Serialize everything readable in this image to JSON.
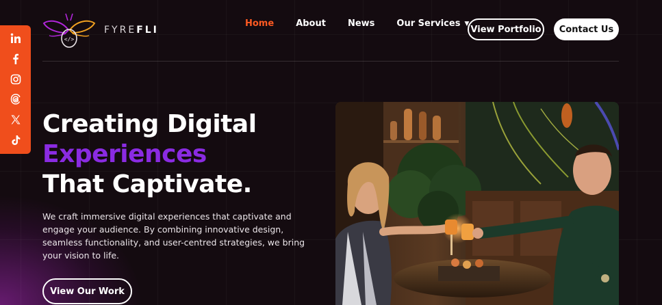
{
  "brand": {
    "logo_text_light": "FYRE",
    "logo_text_bold": "FLI"
  },
  "nav": {
    "items": [
      {
        "label": "Home",
        "active": true
      },
      {
        "label": "About"
      },
      {
        "label": "News"
      },
      {
        "label": "Our Services",
        "has_dropdown": true
      }
    ],
    "portfolio_button": "View Portfolio",
    "contact_button": "Contact Us"
  },
  "social": [
    "linkedin-icon",
    "facebook-icon",
    "instagram-icon",
    "threads-icon",
    "x-icon",
    "tiktok-icon"
  ],
  "hero": {
    "title_line1": "Creating Digital",
    "title_line2": "Experiences",
    "title_line3": "That Captivate.",
    "description": "We craft immersive digital experiences that captivate and engage your audience. By combining innovative design, seamless functionality, and user-centred strategies, we bring your vision to life.",
    "cta_label": "View Our Work"
  },
  "colors": {
    "accent": "#ff5a22",
    "social_bg": "#f04e1c",
    "purple": "#8a2be2",
    "background": "#140b10"
  }
}
